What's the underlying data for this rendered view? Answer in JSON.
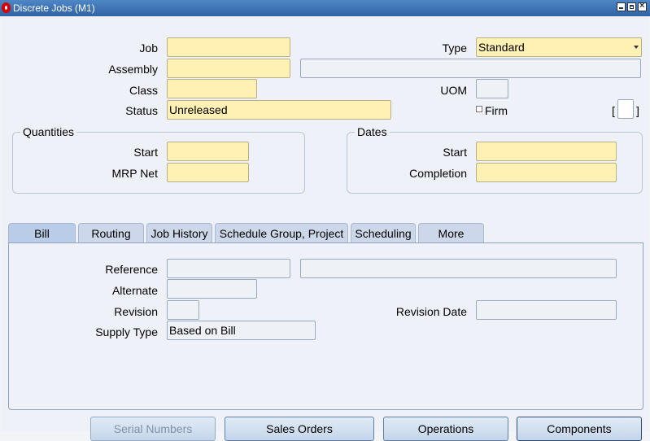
{
  "window": {
    "title": "Discrete Jobs (M1)"
  },
  "header": {
    "job_label": "Job",
    "job_value": "",
    "type_label": "Type",
    "type_value": "Standard",
    "assembly_label": "Assembly",
    "assembly_value": "",
    "assembly_desc": "",
    "class_label": "Class",
    "class_value": "",
    "uom_label": "UOM",
    "uom_value": "",
    "status_label": "Status",
    "status_value": "Unreleased",
    "firm_label": "Firm",
    "flex_open": "[",
    "flex_close": "]"
  },
  "quantities": {
    "title": "Quantities",
    "start_label": "Start",
    "mrp_net_label": "MRP Net"
  },
  "dates": {
    "title": "Dates",
    "start_label": "Start",
    "completion_label": "Completion"
  },
  "tabs": [
    {
      "label": "Bill",
      "active": true
    },
    {
      "label": "Routing"
    },
    {
      "label": "Job History"
    },
    {
      "label": "Schedule Group, Project"
    },
    {
      "label": "Scheduling"
    },
    {
      "label": "More"
    }
  ],
  "bill": {
    "reference_label": "Reference",
    "alternate_label": "Alternate",
    "revision_label": "Revision",
    "revision_date_label": "Revision Date",
    "supply_type_label": "Supply Type",
    "supply_type_value": "Based on Bill"
  },
  "buttons": [
    {
      "label": "Serial Numbers",
      "enabled": false
    },
    {
      "label": "Sales Orders",
      "enabled": true
    },
    {
      "label": "Operations",
      "enabled": true
    },
    {
      "label": "Components",
      "enabled": true
    }
  ]
}
